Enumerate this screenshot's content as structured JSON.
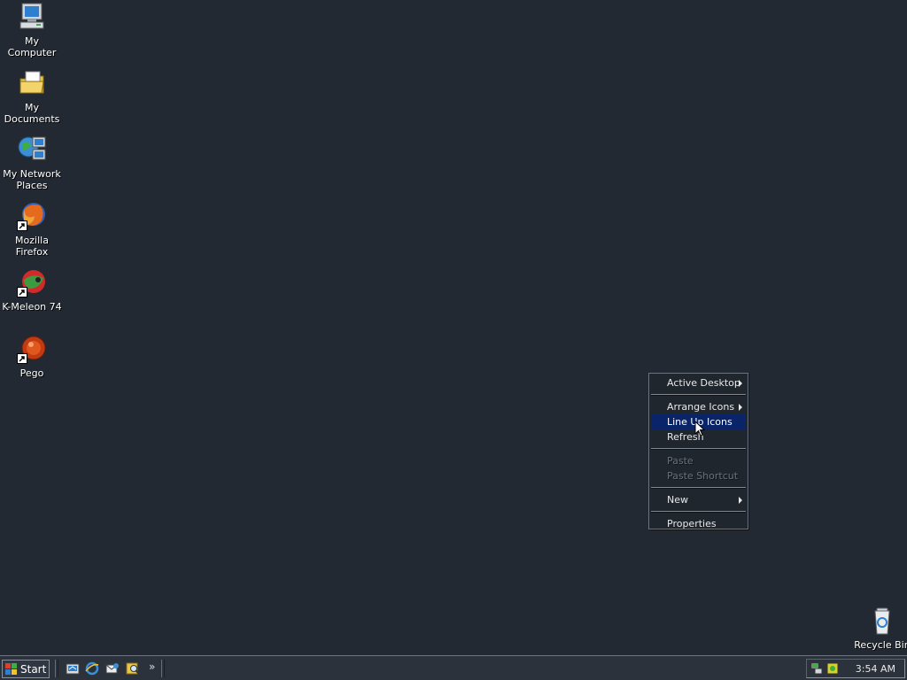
{
  "desktop": {
    "icons": [
      {
        "label": "My Computer"
      },
      {
        "label": "My Documents"
      },
      {
        "label": "My Network Places"
      },
      {
        "label": "Mozilla Firefox"
      },
      {
        "label": "K-Meleon 74"
      },
      {
        "label": "Pego"
      }
    ],
    "recycle_bin": {
      "label": "Recycle Bin"
    }
  },
  "context_menu": {
    "items": [
      {
        "label": "Active Desktop"
      },
      {
        "label": "Arrange Icons"
      },
      {
        "label": "Line Up Icons"
      },
      {
        "label": "Refresh"
      },
      {
        "label": "Paste"
      },
      {
        "label": "Paste Shortcut"
      },
      {
        "label": "New"
      },
      {
        "label": "Properties"
      }
    ]
  },
  "taskbar": {
    "start_label": "Start",
    "overflow_label": "»",
    "clock": "3:54 AM"
  },
  "colors": {
    "desktop_background": "#232932",
    "menu_highlight": "#0a246a"
  }
}
